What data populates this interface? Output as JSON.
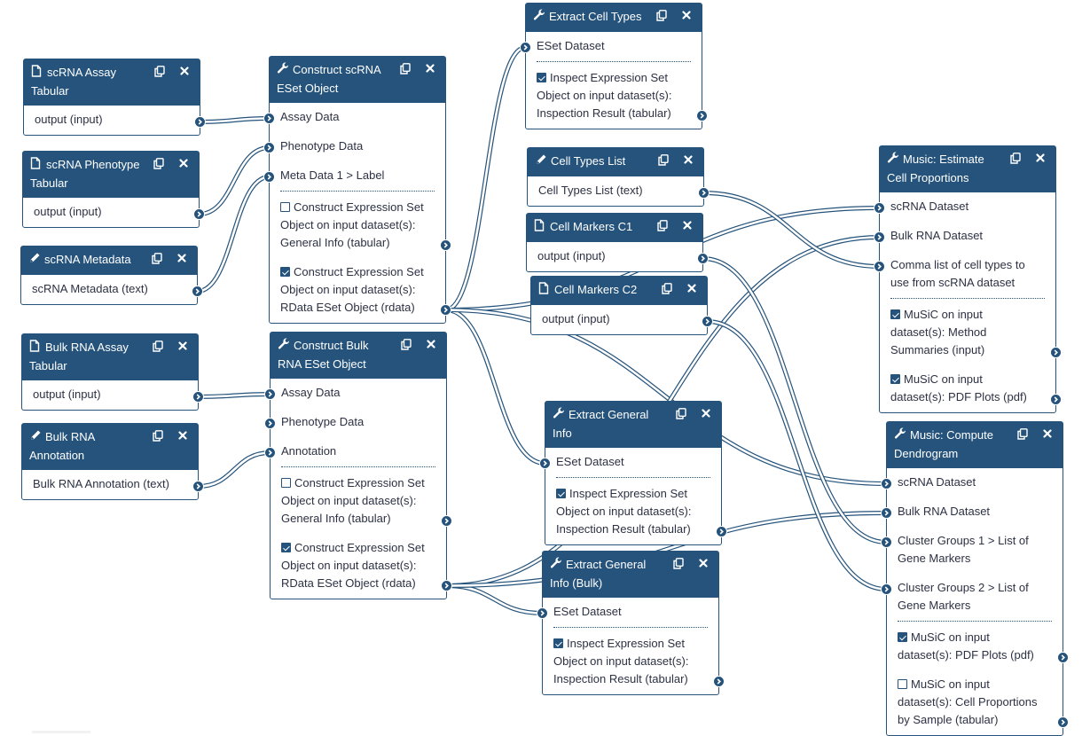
{
  "colors": {
    "node_header": "#25537b",
    "node_border": "#25537b",
    "edge": "#25537b",
    "background": "#ffffff"
  },
  "nodes": [
    {
      "id": "n1",
      "title": "scRNA Assay Tabular",
      "icon": "file-icon",
      "inputs": [],
      "outputs": [
        {
          "label": "output (input)"
        }
      ]
    },
    {
      "id": "n2",
      "title": "scRNA Phenotype Tabular",
      "icon": "file-icon",
      "inputs": [],
      "outputs": [
        {
          "label": "output (input)"
        }
      ]
    },
    {
      "id": "n3",
      "title": "scRNA Metadata",
      "icon": "pencil-icon",
      "inputs": [],
      "outputs": [
        {
          "label": "scRNA Metadata (text)"
        }
      ]
    },
    {
      "id": "n4",
      "title": "Bulk RNA Assay Tabular",
      "icon": "file-icon",
      "inputs": [],
      "outputs": [
        {
          "label": "output (input)"
        }
      ]
    },
    {
      "id": "n5",
      "title": "Bulk RNA Annotation",
      "icon": "pencil-icon",
      "inputs": [],
      "outputs": [
        {
          "label": "Bulk RNA Annotation (text)"
        }
      ]
    },
    {
      "id": "n6",
      "title": "Construct scRNA ESet Object",
      "icon": "wrench-icon",
      "inputs": [
        {
          "label": "Assay Data"
        },
        {
          "label": "Phenotype Data"
        },
        {
          "label": "Meta Data 1 > Label"
        }
      ],
      "outputs": [
        {
          "label": "Construct Expression Set Object on input dataset(s): General Info (tabular)",
          "checked": false
        },
        {
          "label": "Construct Expression Set Object on input dataset(s): RData ESet Object (rdata)",
          "checked": true
        }
      ]
    },
    {
      "id": "n7",
      "title": "Construct Bulk RNA ESet Object",
      "icon": "wrench-icon",
      "inputs": [
        {
          "label": "Assay Data"
        },
        {
          "label": "Phenotype Data"
        },
        {
          "label": "Annotation"
        }
      ],
      "outputs": [
        {
          "label": "Construct Expression Set Object on input dataset(s): General Info (tabular)",
          "checked": false
        },
        {
          "label": "Construct Expression Set Object on input dataset(s): RData ESet Object (rdata)",
          "checked": true
        }
      ]
    },
    {
      "id": "n8",
      "title": "Extract Cell Types",
      "icon": "wrench-icon",
      "inputs": [
        {
          "label": "ESet Dataset"
        }
      ],
      "outputs": [
        {
          "label": "Inspect Expression Set Object on input dataset(s): Inspection Result (tabular)",
          "checked": true
        }
      ]
    },
    {
      "id": "n9",
      "title": "Cell Types List",
      "icon": "pencil-icon",
      "inputs": [],
      "outputs": [
        {
          "label": "Cell Types List (text)"
        }
      ]
    },
    {
      "id": "n10",
      "title": "Cell Markers C1",
      "icon": "file-icon",
      "inputs": [],
      "outputs": [
        {
          "label": "output (input)"
        }
      ]
    },
    {
      "id": "n11",
      "title": "Cell Markers C2",
      "icon": "file-icon",
      "inputs": [],
      "outputs": [
        {
          "label": "output (input)"
        }
      ]
    },
    {
      "id": "n12",
      "title": "Extract General Info",
      "icon": "wrench-icon",
      "inputs": [
        {
          "label": "ESet Dataset"
        }
      ],
      "outputs": [
        {
          "label": "Inspect Expression Set Object on input dataset(s): Inspection Result (tabular)",
          "checked": true
        }
      ]
    },
    {
      "id": "n13",
      "title": "Extract General Info (Bulk)",
      "icon": "wrench-icon",
      "inputs": [
        {
          "label": "ESet Dataset"
        }
      ],
      "outputs": [
        {
          "label": "Inspect Expression Set Object on input dataset(s): Inspection Result (tabular)",
          "checked": true
        }
      ]
    },
    {
      "id": "n14",
      "title": "Music: Estimate Cell Proportions",
      "icon": "wrench-icon",
      "inputs": [
        {
          "label": "scRNA Dataset"
        },
        {
          "label": "Bulk RNA Dataset"
        },
        {
          "label": "Comma list of cell types to use from scRNA dataset"
        }
      ],
      "outputs": [
        {
          "label": "MuSiC on input dataset(s): Method Summaries (input)",
          "checked": true
        },
        {
          "label": "MuSiC on input dataset(s): PDF Plots (pdf)",
          "checked": true
        }
      ]
    },
    {
      "id": "n15",
      "title": "Music: Compute Dendrogram",
      "icon": "wrench-icon",
      "inputs": [
        {
          "label": "scRNA Dataset"
        },
        {
          "label": "Bulk RNA Dataset"
        },
        {
          "label": "Cluster Groups 1 > List of Gene Markers"
        },
        {
          "label": "Cluster Groups 2 > List of Gene Markers"
        }
      ],
      "outputs": [
        {
          "label": "MuSiC on input dataset(s): PDF Plots (pdf)",
          "checked": true
        },
        {
          "label": "MuSiC on input dataset(s): Cell Proportions by Sample (tabular)",
          "checked": false
        }
      ]
    }
  ],
  "connections": [
    {
      "from": "n1.out.0",
      "to": "n6.in.0"
    },
    {
      "from": "n2.out.0",
      "to": "n6.in.1"
    },
    {
      "from": "n3.out.0",
      "to": "n6.in.2"
    },
    {
      "from": "n4.out.0",
      "to": "n7.in.0"
    },
    {
      "from": "n5.out.0",
      "to": "n7.in.2"
    },
    {
      "from": "n6.out.1",
      "to": "n8.in.0"
    },
    {
      "from": "n6.out.1",
      "to": "n12.in.0"
    },
    {
      "from": "n6.out.1",
      "to": "n14.in.0"
    },
    {
      "from": "n6.out.1",
      "to": "n15.in.0"
    },
    {
      "from": "n7.out.1",
      "to": "n13.in.0"
    },
    {
      "from": "n7.out.1",
      "to": "n14.in.1"
    },
    {
      "from": "n7.out.1",
      "to": "n15.in.1"
    },
    {
      "from": "n9.out.0",
      "to": "n14.in.2"
    },
    {
      "from": "n10.out.0",
      "to": "n15.in.2"
    },
    {
      "from": "n11.out.0",
      "to": "n15.in.3"
    }
  ]
}
